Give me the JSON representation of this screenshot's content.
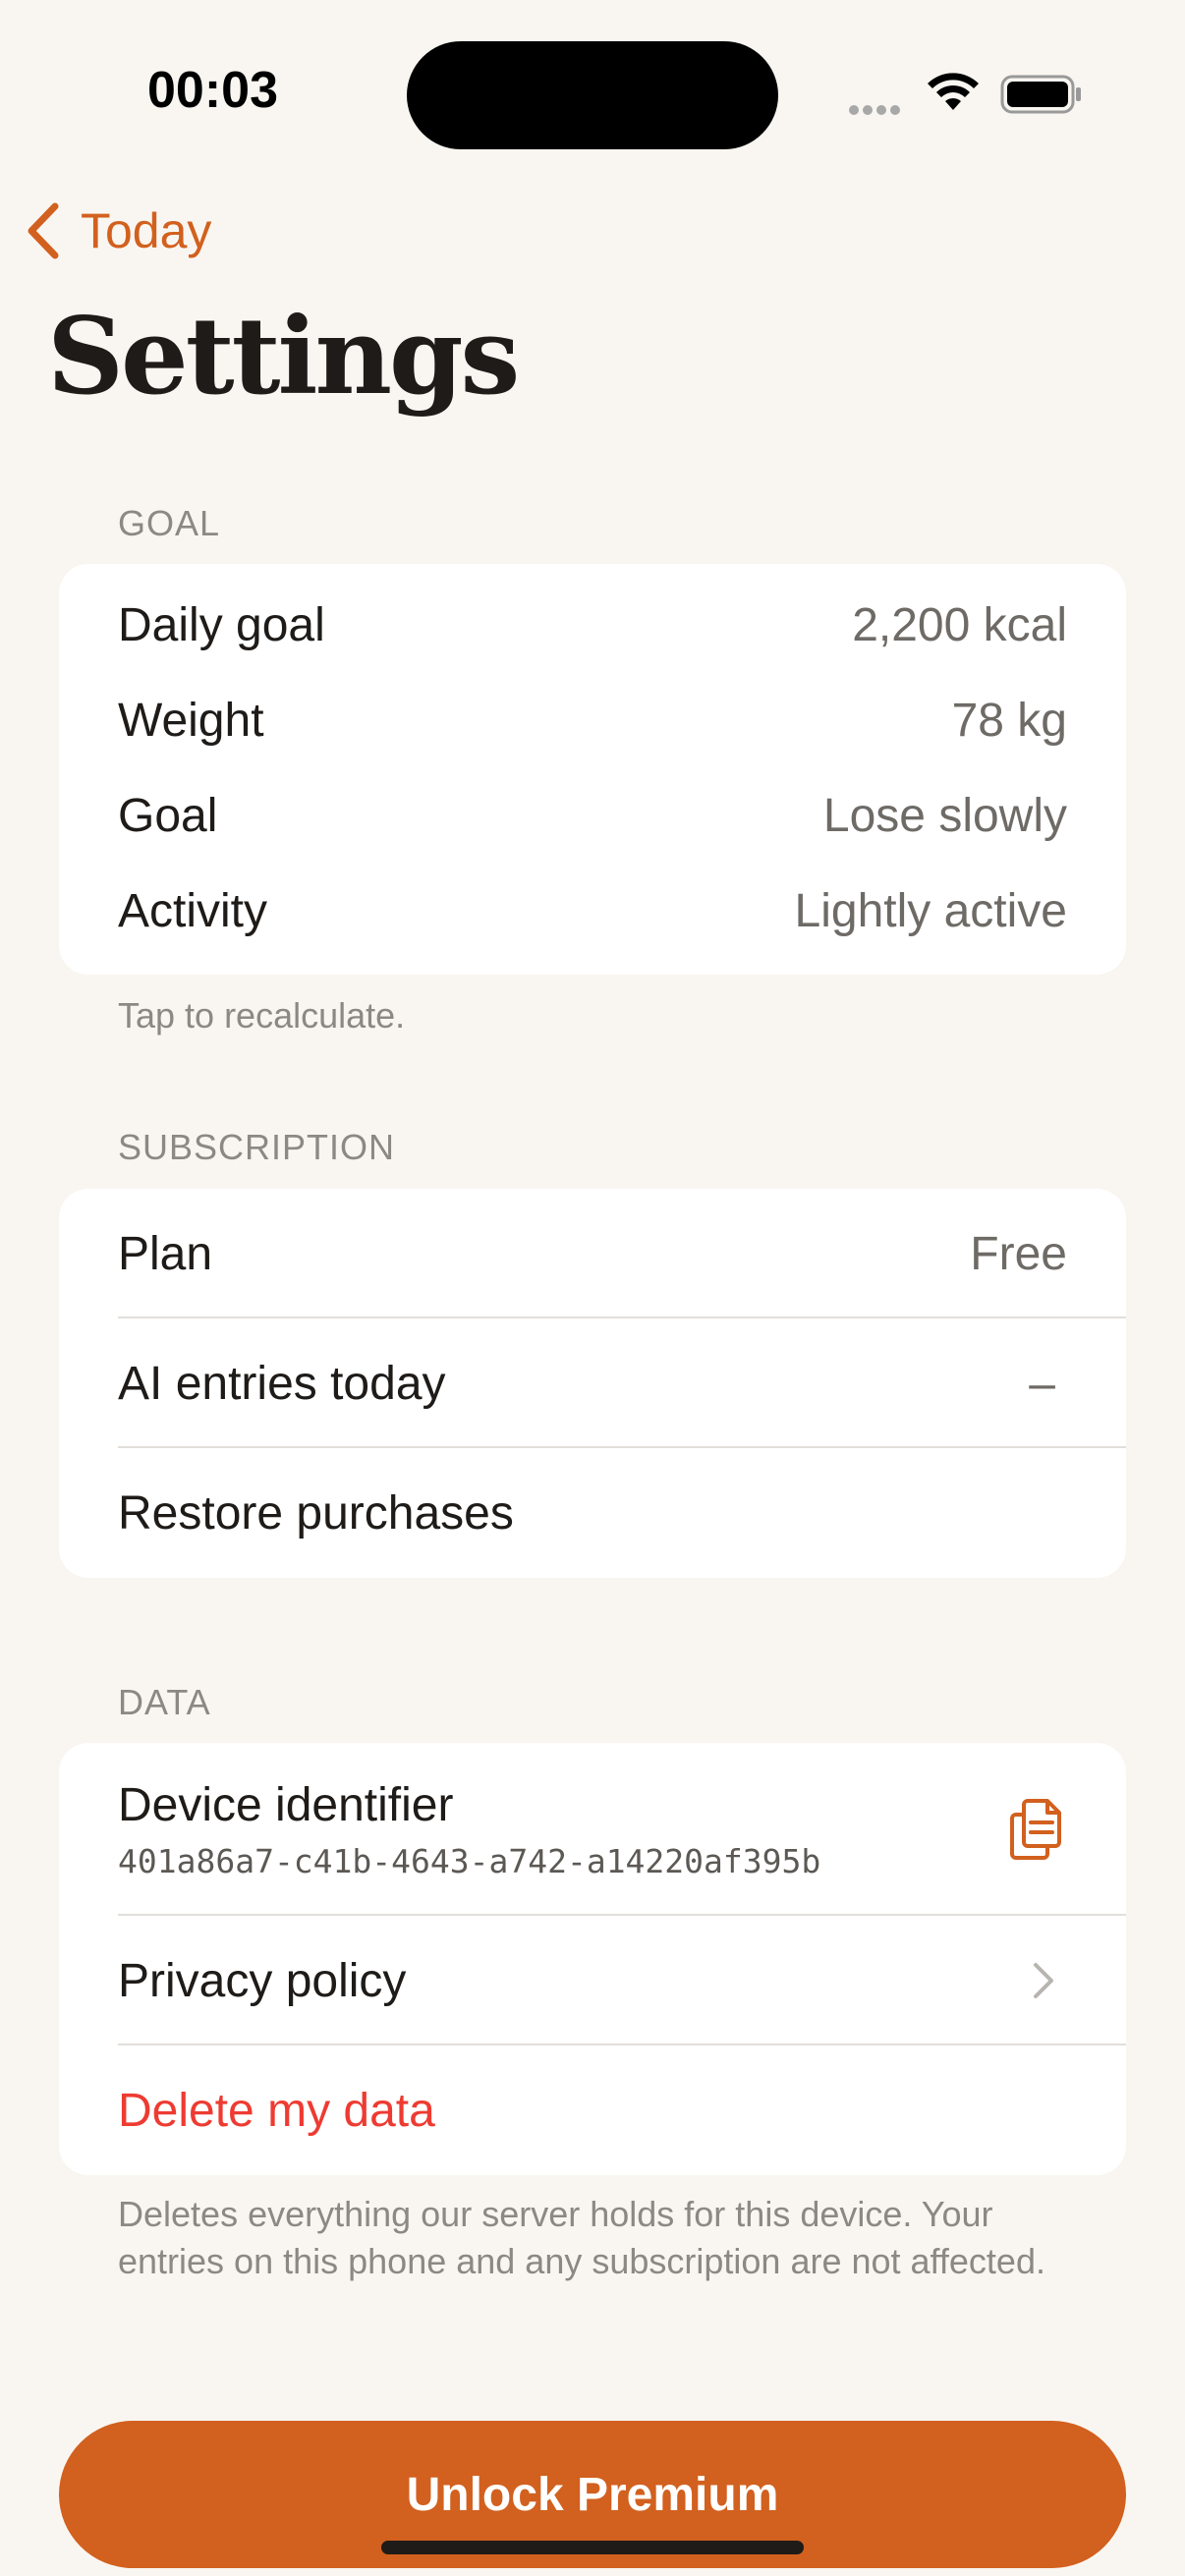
{
  "status_bar": {
    "time": "00:03"
  },
  "nav": {
    "back_label": "Today",
    "title": "Settings"
  },
  "goal_section": {
    "header": "GOAL",
    "rows": [
      {
        "label": "Daily goal",
        "value": "2,200 kcal"
      },
      {
        "label": "Weight",
        "value": "78 kg"
      },
      {
        "label": "Goal",
        "value": "Lose slowly"
      },
      {
        "label": "Activity",
        "value": "Lightly active"
      }
    ],
    "footnote": "Tap to recalculate."
  },
  "subscription_section": {
    "header": "SUBSCRIPTION",
    "plan_label": "Plan",
    "plan_value": "Free",
    "ai_label": "AI entries today",
    "ai_value": "–",
    "restore_label": "Restore purchases"
  },
  "data_section": {
    "header": "DATA",
    "device_label": "Device identifier",
    "device_id": "401a86a7-c41b-4643-a742-a14220af395b",
    "privacy_label": "Privacy policy",
    "delete_label": "Delete my data",
    "footnote": "Deletes everything our server holds for this device. Your entries on this phone and any subscription are not affected."
  },
  "cta": {
    "label": "Unlock Premium"
  },
  "colors": {
    "accent": "#D2601E",
    "danger": "#EE3B32",
    "background": "#F9F6F1"
  },
  "icons": {
    "back": "chevron-left-icon",
    "copy": "copy-icon",
    "chevron": "chevron-right-icon"
  }
}
